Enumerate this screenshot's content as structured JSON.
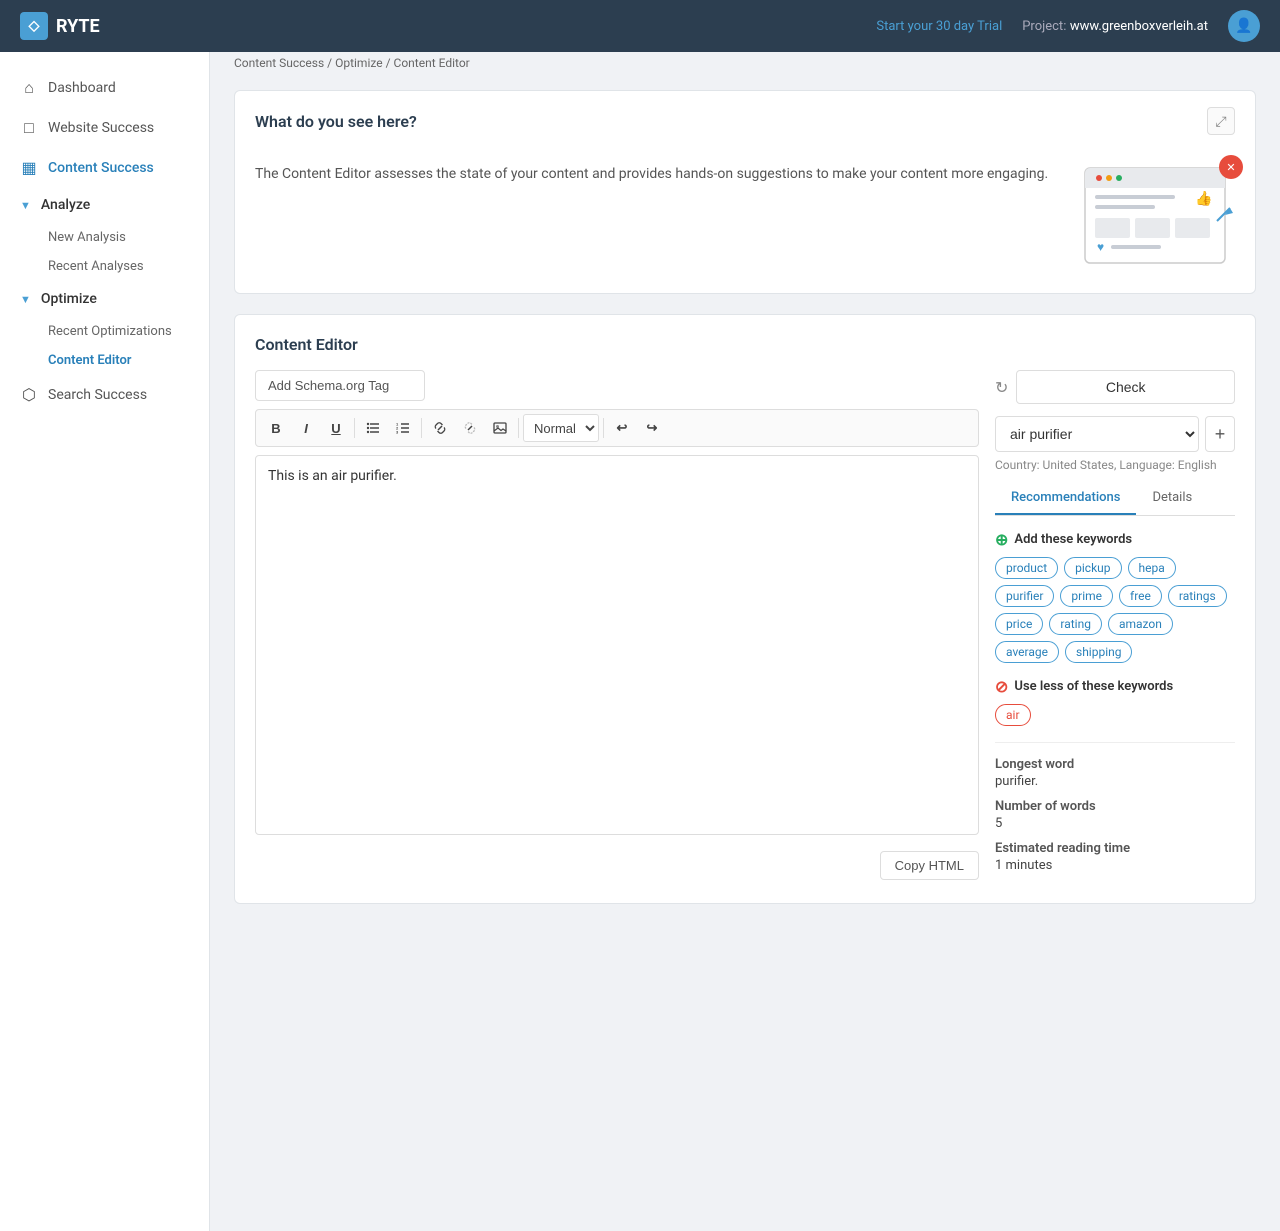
{
  "topnav": {
    "logo_text": "RYTE",
    "trial_label": "Start your 30 day Trial",
    "project_label": "Project:",
    "project_name": "www.greenboxverleih.at",
    "logo_symbol": "◇"
  },
  "sidebar": {
    "items": [
      {
        "id": "dashboard",
        "label": "Dashboard",
        "icon": "⌂",
        "active": false
      },
      {
        "id": "website-success",
        "label": "Website Success",
        "icon": "□",
        "active": false
      },
      {
        "id": "content-success",
        "label": "Content Success",
        "icon": "▦",
        "active": true
      }
    ],
    "analyze_section": {
      "label": "Analyze",
      "items": [
        {
          "id": "new-analysis",
          "label": "New Analysis",
          "active": false
        },
        {
          "id": "recent-analyses",
          "label": "Recent Analyses",
          "active": false
        }
      ]
    },
    "optimize_section": {
      "label": "Optimize",
      "items": [
        {
          "id": "recent-optimizations",
          "label": "Recent Optimizations",
          "active": false
        },
        {
          "id": "content-editor",
          "label": "Content Editor",
          "active": true
        }
      ]
    },
    "search_success": {
      "label": "Search Success",
      "icon": "⬡",
      "active": false
    }
  },
  "page": {
    "title": "Content Editor",
    "breadcrumb": [
      "Content Success",
      "Optimize",
      "Content Editor"
    ]
  },
  "info_card": {
    "title": "What do you see here?",
    "description": "The Content Editor assesses the state of your content and provides hands-on suggestions to make your content more engaging."
  },
  "editor_card": {
    "title": "Content Editor",
    "schema_tag_label": "Add Schema.org Tag",
    "toolbar": {
      "bold": "B",
      "italic": "I",
      "underline": "U",
      "ul": "≡",
      "ol": "≡",
      "link": "🔗",
      "unlink": "⛓",
      "image": "🖼",
      "format": "Normal",
      "undo": "↩",
      "redo": "↪"
    },
    "content": "This is an air purifier.",
    "copy_html_label": "Copy HTML"
  },
  "right_panel": {
    "check_label": "Check",
    "keyword": "air purifier",
    "country_lang": "Country: United States, Language: English",
    "tabs": [
      "Recommendations",
      "Details"
    ],
    "active_tab": "Recommendations",
    "add_keywords_title": "Add these keywords",
    "add_keywords": [
      "product",
      "pickup",
      "hepa",
      "purifier",
      "prime",
      "free",
      "ratings",
      "price",
      "rating",
      "amazon",
      "average",
      "shipping"
    ],
    "use_less_title": "Use less of these keywords",
    "use_less_keywords": [
      "air"
    ],
    "stats": {
      "longest_word_label": "Longest word",
      "longest_word_value": "purifier.",
      "word_count_label": "Number of words",
      "word_count_value": "5",
      "reading_time_label": "Estimated reading time",
      "reading_time_value": "1 minutes"
    }
  }
}
